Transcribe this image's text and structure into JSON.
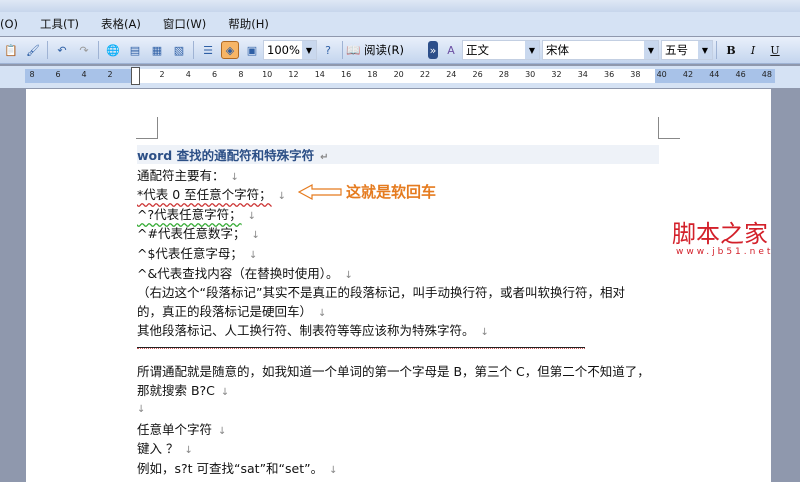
{
  "menu": [
    "(O)",
    "工具(T)",
    "表格(A)",
    "窗口(W)",
    "帮助(H)"
  ],
  "toolbar": {
    "zoom": "100%",
    "read_label": "阅读(R)",
    "style": "正文",
    "font": "宋体",
    "size": "五号",
    "bold": "B",
    "italic": "I",
    "underline": "U"
  },
  "ruler": {
    "left": [
      "8",
      "6",
      "4",
      "2"
    ],
    "right": [
      "2",
      "4",
      "6",
      "8",
      "10",
      "12",
      "14",
      "16",
      "18",
      "20",
      "22",
      "24",
      "26",
      "28",
      "30",
      "32",
      "34",
      "36",
      "38",
      "40",
      "42",
      "44",
      "46",
      "48"
    ]
  },
  "doc": {
    "title": "word 查找的通配符和特殊字符",
    "lines": [
      "通配符主要有：",
      "*代表 0 至任意个字符；",
      "^?代表任意字符；",
      "^#代表任意数字；",
      "^$代表任意字母；",
      "^&代表查找内容（在替换时使用）。",
      "（右边这个“段落标记”其实不是真正的段落标记，叫手动换行符，或者叫软换行符，相对",
      "的，真正的段落标记是硬回车）",
      "其他段落标记、人工换行符、制表符等等应该称为特殊字符。"
    ],
    "lines2": [
      "所谓通配就是随意的，如我知道一个单词的第一个字母是 B，第三个 C，但第二个不知道了，",
      "那就搜索 B?C",
      "",
      "任意单个字符",
      "键入 ？",
      "例如，s?t 可查找“sat”和“set”。"
    ],
    "annotation": "这就是软回车"
  },
  "watermark": {
    "name": "脚本之家",
    "url": "www.jb51.net"
  }
}
